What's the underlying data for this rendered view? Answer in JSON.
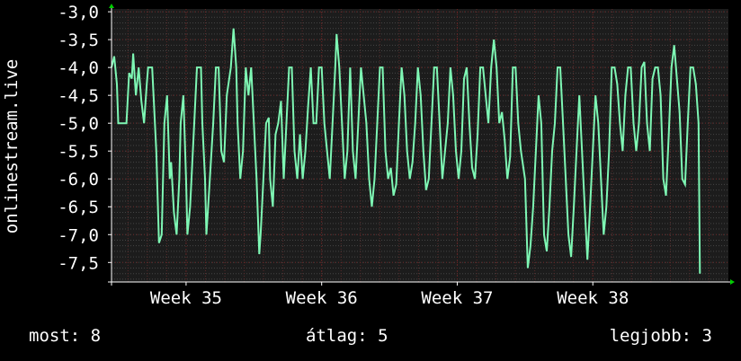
{
  "chart_data": {
    "type": "line",
    "ylabel": "onlinestream.live",
    "ylim": [
      -7.85,
      -2.95
    ],
    "yticks": [
      "-3,0",
      "-3,5",
      "-4,0",
      "-4,5",
      "-5,0",
      "-5,5",
      "-6,0",
      "-6,5",
      "-7,0",
      "-7,5"
    ],
    "ytick_values": [
      -3.0,
      -3.5,
      -4.0,
      -4.5,
      -5.0,
      -5.5,
      -6.0,
      -6.5,
      -7.0,
      -7.5
    ],
    "xticks": [
      "Week 35",
      "Week 36",
      "Week 37",
      "Week 38"
    ],
    "xtick_values": [
      35,
      36,
      37,
      38
    ],
    "xlim": [
      34.45,
      39.0
    ],
    "grid": true,
    "colors": {
      "background": "#000000",
      "plot_bg": "#1c1c1c",
      "grid": "#444444",
      "minor_grid": "#5a2a2a",
      "line": "#7ef7b4",
      "axis": "#ffffff",
      "arrow": "#00cc00"
    },
    "series": [
      {
        "values": [
          [
            34.45,
            -4.0
          ],
          [
            34.47,
            -3.8
          ],
          [
            34.49,
            -4.3
          ],
          [
            34.5,
            -5.0
          ],
          [
            34.53,
            -5.0
          ],
          [
            34.56,
            -5.0
          ],
          [
            34.58,
            -4.1
          ],
          [
            34.6,
            -4.2
          ],
          [
            34.61,
            -3.75
          ],
          [
            34.63,
            -4.5
          ],
          [
            34.65,
            -4.0
          ],
          [
            34.67,
            -4.6
          ],
          [
            34.69,
            -5.0
          ],
          [
            34.71,
            -4.3
          ],
          [
            34.72,
            -4.0
          ],
          [
            34.75,
            -4.0
          ],
          [
            34.78,
            -5.5
          ],
          [
            34.8,
            -7.15
          ],
          [
            34.82,
            -7.0
          ],
          [
            34.84,
            -5.0
          ],
          [
            34.86,
            -4.5
          ],
          [
            34.88,
            -6.0
          ],
          [
            34.89,
            -5.7
          ],
          [
            34.91,
            -6.6
          ],
          [
            34.93,
            -7.0
          ],
          [
            34.95,
            -6.0
          ],
          [
            34.96,
            -5.0
          ],
          [
            34.98,
            -4.5
          ],
          [
            35.0,
            -6.0
          ],
          [
            35.01,
            -7.0
          ],
          [
            35.03,
            -6.5
          ],
          [
            35.06,
            -5.0
          ],
          [
            35.08,
            -4.0
          ],
          [
            35.11,
            -4.0
          ],
          [
            35.12,
            -5.0
          ],
          [
            35.14,
            -6.0
          ],
          [
            35.15,
            -7.0
          ],
          [
            35.17,
            -6.2
          ],
          [
            35.2,
            -5.0
          ],
          [
            35.22,
            -4.0
          ],
          [
            35.24,
            -4.0
          ],
          [
            35.26,
            -5.5
          ],
          [
            35.28,
            -5.7
          ],
          [
            35.3,
            -4.5
          ],
          [
            35.33,
            -4.0
          ],
          [
            35.35,
            -3.3
          ],
          [
            35.37,
            -4.0
          ],
          [
            35.38,
            -5.0
          ],
          [
            35.4,
            -6.0
          ],
          [
            35.42,
            -5.5
          ],
          [
            35.44,
            -4.0
          ],
          [
            35.46,
            -4.5
          ],
          [
            35.48,
            -4.0
          ],
          [
            35.5,
            -5.0
          ],
          [
            35.52,
            -6.0
          ],
          [
            35.54,
            -7.35
          ],
          [
            35.55,
            -7.0
          ],
          [
            35.57,
            -6.0
          ],
          [
            35.59,
            -5.0
          ],
          [
            35.61,
            -4.9
          ],
          [
            35.62,
            -6.0
          ],
          [
            35.64,
            -6.5
          ],
          [
            35.66,
            -5.2
          ],
          [
            35.68,
            -5.0
          ],
          [
            35.7,
            -4.6
          ],
          [
            35.72,
            -6.0
          ],
          [
            35.74,
            -5.0
          ],
          [
            35.76,
            -4.0
          ],
          [
            35.78,
            -4.0
          ],
          [
            35.8,
            -5.5
          ],
          [
            35.82,
            -6.0
          ],
          [
            35.84,
            -5.2
          ],
          [
            35.86,
            -6.0
          ],
          [
            35.88,
            -5.5
          ],
          [
            35.9,
            -4.7
          ],
          [
            35.92,
            -4.0
          ],
          [
            35.94,
            -5.0
          ],
          [
            35.96,
            -5.0
          ],
          [
            35.98,
            -4.0
          ],
          [
            36.0,
            -4.0
          ],
          [
            36.02,
            -5.0
          ],
          [
            36.04,
            -5.5
          ],
          [
            36.06,
            -6.0
          ],
          [
            36.08,
            -5.0
          ],
          [
            36.1,
            -4.0
          ],
          [
            36.11,
            -3.4
          ],
          [
            36.13,
            -4.0
          ],
          [
            36.15,
            -5.0
          ],
          [
            36.17,
            -6.0
          ],
          [
            36.19,
            -5.5
          ],
          [
            36.21,
            -4.0
          ],
          [
            36.23,
            -5.5
          ],
          [
            36.25,
            -6.0
          ],
          [
            36.27,
            -5.0
          ],
          [
            36.29,
            -4.0
          ],
          [
            36.31,
            -4.5
          ],
          [
            36.33,
            -5.0
          ],
          [
            36.35,
            -6.0
          ],
          [
            36.37,
            -6.5
          ],
          [
            36.39,
            -6.0
          ],
          [
            36.41,
            -5.0
          ],
          [
            36.43,
            -4.0
          ],
          [
            36.45,
            -4.0
          ],
          [
            36.47,
            -5.5
          ],
          [
            36.49,
            -6.0
          ],
          [
            36.51,
            -5.8
          ],
          [
            36.53,
            -6.3
          ],
          [
            36.55,
            -6.1
          ],
          [
            36.57,
            -5.0
          ],
          [
            36.59,
            -4.0
          ],
          [
            36.61,
            -4.5
          ],
          [
            36.63,
            -5.5
          ],
          [
            36.65,
            -6.0
          ],
          [
            36.67,
            -5.7
          ],
          [
            36.69,
            -5.0
          ],
          [
            36.71,
            -4.0
          ],
          [
            36.73,
            -4.5
          ],
          [
            36.75,
            -5.5
          ],
          [
            36.77,
            -6.2
          ],
          [
            36.79,
            -6.0
          ],
          [
            36.81,
            -5.0
          ],
          [
            36.83,
            -4.0
          ],
          [
            36.85,
            -4.0
          ],
          [
            36.87,
            -5.0
          ],
          [
            36.89,
            -6.0
          ],
          [
            36.91,
            -5.5
          ],
          [
            36.93,
            -5.0
          ],
          [
            36.95,
            -4.0
          ],
          [
            36.97,
            -4.5
          ],
          [
            36.99,
            -5.5
          ],
          [
            37.01,
            -6.0
          ],
          [
            37.03,
            -5.5
          ],
          [
            37.05,
            -4.2
          ],
          [
            37.07,
            -4.0
          ],
          [
            37.09,
            -5.0
          ],
          [
            37.11,
            -5.8
          ],
          [
            37.13,
            -6.0
          ],
          [
            37.15,
            -5.2
          ],
          [
            37.17,
            -4.0
          ],
          [
            37.19,
            -4.0
          ],
          [
            37.21,
            -4.5
          ],
          [
            37.23,
            -5.0
          ],
          [
            37.25,
            -4.0
          ],
          [
            37.27,
            -3.5
          ],
          [
            37.29,
            -4.0
          ],
          [
            37.31,
            -5.0
          ],
          [
            37.33,
            -4.8
          ],
          [
            37.35,
            -5.3
          ],
          [
            37.37,
            -6.0
          ],
          [
            37.39,
            -5.6
          ],
          [
            37.41,
            -4.0
          ],
          [
            37.43,
            -4.0
          ],
          [
            37.45,
            -5.0
          ],
          [
            37.47,
            -5.5
          ],
          [
            37.5,
            -6.0
          ],
          [
            37.52,
            -7.6
          ],
          [
            37.54,
            -7.2
          ],
          [
            37.56,
            -6.5
          ],
          [
            37.58,
            -5.5
          ],
          [
            37.6,
            -4.5
          ],
          [
            37.62,
            -5.0
          ],
          [
            37.64,
            -7.0
          ],
          [
            37.66,
            -7.3
          ],
          [
            37.68,
            -6.5
          ],
          [
            37.7,
            -5.5
          ],
          [
            37.72,
            -5.0
          ],
          [
            37.74,
            -4.0
          ],
          [
            37.76,
            -4.0
          ],
          [
            37.78,
            -5.0
          ],
          [
            37.8,
            -6.0
          ],
          [
            37.82,
            -7.0
          ],
          [
            37.84,
            -7.4
          ],
          [
            37.86,
            -6.5
          ],
          [
            37.88,
            -5.5
          ],
          [
            37.9,
            -4.5
          ],
          [
            37.92,
            -5.5
          ],
          [
            37.94,
            -6.5
          ],
          [
            37.96,
            -7.45
          ],
          [
            37.98,
            -6.5
          ],
          [
            38.0,
            -5.5
          ],
          [
            38.02,
            -4.5
          ],
          [
            38.04,
            -5.0
          ],
          [
            38.06,
            -6.0
          ],
          [
            38.08,
            -7.0
          ],
          [
            38.1,
            -6.5
          ],
          [
            38.12,
            -5.5
          ],
          [
            38.14,
            -4.0
          ],
          [
            38.16,
            -4.0
          ],
          [
            38.18,
            -4.3
          ],
          [
            38.2,
            -5.0
          ],
          [
            38.22,
            -5.5
          ],
          [
            38.24,
            -4.5
          ],
          [
            38.26,
            -4.0
          ],
          [
            38.28,
            -4.0
          ],
          [
            38.3,
            -5.0
          ],
          [
            38.32,
            -5.5
          ],
          [
            38.34,
            -5.0
          ],
          [
            38.36,
            -4.0
          ],
          [
            38.38,
            -3.9
          ],
          [
            38.4,
            -5.0
          ],
          [
            38.42,
            -5.5
          ],
          [
            38.44,
            -4.2
          ],
          [
            38.46,
            -4.0
          ],
          [
            38.48,
            -4.0
          ],
          [
            38.5,
            -4.5
          ],
          [
            38.52,
            -6.0
          ],
          [
            38.54,
            -6.3
          ],
          [
            38.56,
            -5.2
          ],
          [
            38.58,
            -4.0
          ],
          [
            38.6,
            -3.6
          ],
          [
            38.62,
            -4.2
          ],
          [
            38.64,
            -4.8
          ],
          [
            38.66,
            -6.0
          ],
          [
            38.68,
            -6.1
          ],
          [
            38.7,
            -5.0
          ],
          [
            38.72,
            -4.0
          ],
          [
            38.74,
            -4.0
          ],
          [
            38.76,
            -4.3
          ],
          [
            38.78,
            -5.0
          ],
          [
            38.79,
            -7.7
          ]
        ]
      }
    ]
  },
  "footer": {
    "current": "most: 8",
    "average": "átlag: 5",
    "best": "legjobb: 3"
  }
}
